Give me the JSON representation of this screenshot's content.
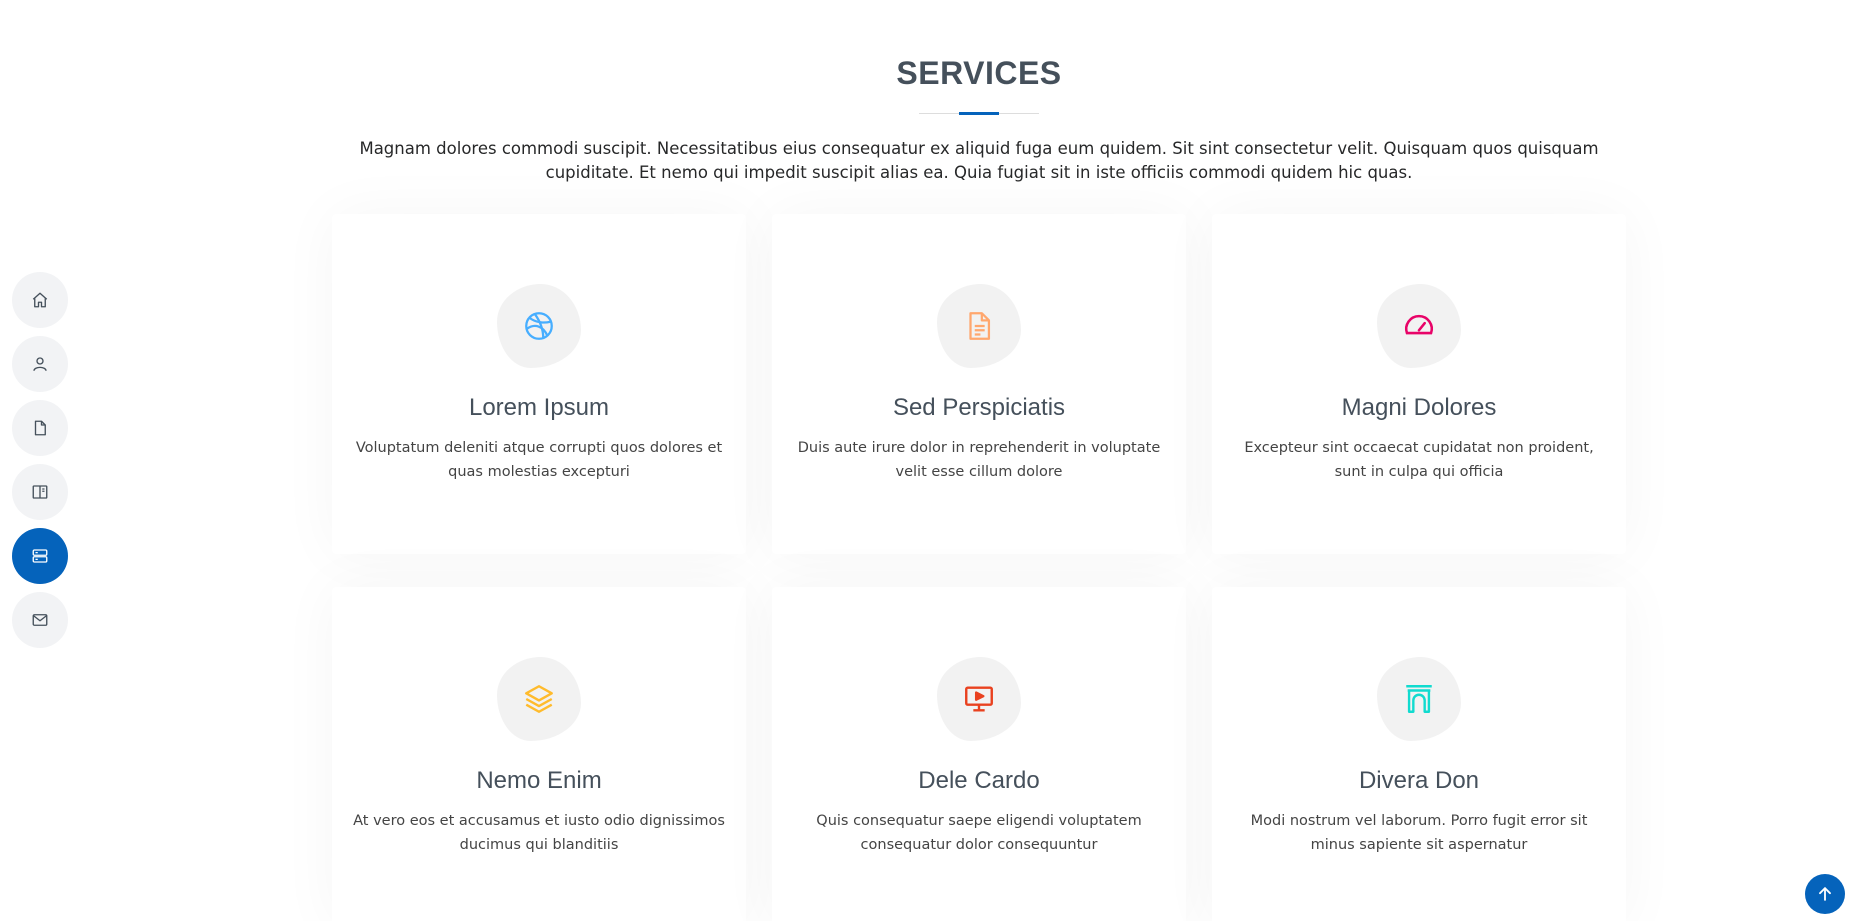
{
  "nav": {
    "items": [
      {
        "icon": "home-icon"
      },
      {
        "icon": "person-icon"
      },
      {
        "icon": "file-icon"
      },
      {
        "icon": "book-icon"
      },
      {
        "icon": "server-icon",
        "active": true
      },
      {
        "icon": "envelope-icon"
      }
    ]
  },
  "services": {
    "title": "SERVICES",
    "intro": "Magnam dolores commodi suscipit. Necessitatibus eius consequatur ex aliquid fuga eum quidem. Sit sint consectetur velit. Quisquam quos quisquam cupiditate. Et nemo qui impedit suscipit alias ea. Quia fugiat sit in iste officiis commodi quidem hic quas.",
    "cards": [
      {
        "title": "Lorem Ipsum",
        "text": "Voluptatum deleniti atque corrupti quos dolores et quas molestias excepturi",
        "icon": "dribbble-icon",
        "color": "#47aeff"
      },
      {
        "title": "Sed Perspiciatis",
        "text": "Duis aute irure dolor in reprehenderit in voluptate velit esse cillum dolore",
        "icon": "file-text-icon",
        "color": "#ffa76e"
      },
      {
        "title": "Magni Dolores",
        "text": "Excepteur sint occaecat cupidatat non proident, sunt in culpa qui officia",
        "icon": "speedometer-icon",
        "color": "#e80368"
      },
      {
        "title": "Nemo Enim",
        "text": "At vero eos et accusamus et iusto odio dignissimos ducimus qui blanditiis",
        "icon": "layers-icon",
        "color": "#ffbb2c"
      },
      {
        "title": "Dele Cardo",
        "text": "Quis consequatur saepe eligendi voluptatem consequatur dolor consequuntur",
        "icon": "presentation-icon",
        "color": "#e9411f"
      },
      {
        "title": "Divera Don",
        "text": "Modi nostrum vel laborum. Porro fugit error sit minus sapiente sit aspernatur",
        "icon": "arch-icon",
        "color": "#11dbcf"
      }
    ]
  },
  "colors": {
    "accent": "#0563bb",
    "heading": "#45505b",
    "nav_bg": "#f2f3f5"
  },
  "back_to_top": {
    "icon": "arrow-up-icon"
  }
}
